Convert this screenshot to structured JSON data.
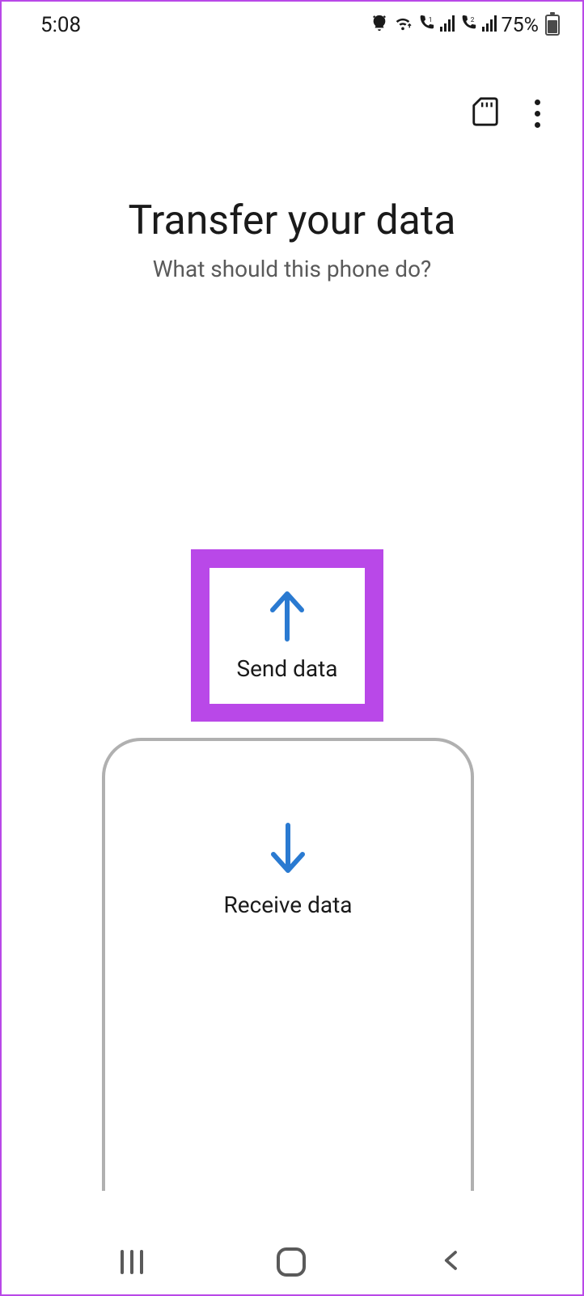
{
  "status_bar": {
    "time": "5:08",
    "battery_pct": "75%"
  },
  "header": {
    "title": "Transfer your data",
    "subtitle": "What should this phone do?"
  },
  "options": {
    "send": "Send data",
    "receive": "Receive data"
  },
  "colors": {
    "highlight": "#b948e8",
    "arrow": "#2a7ad1"
  }
}
